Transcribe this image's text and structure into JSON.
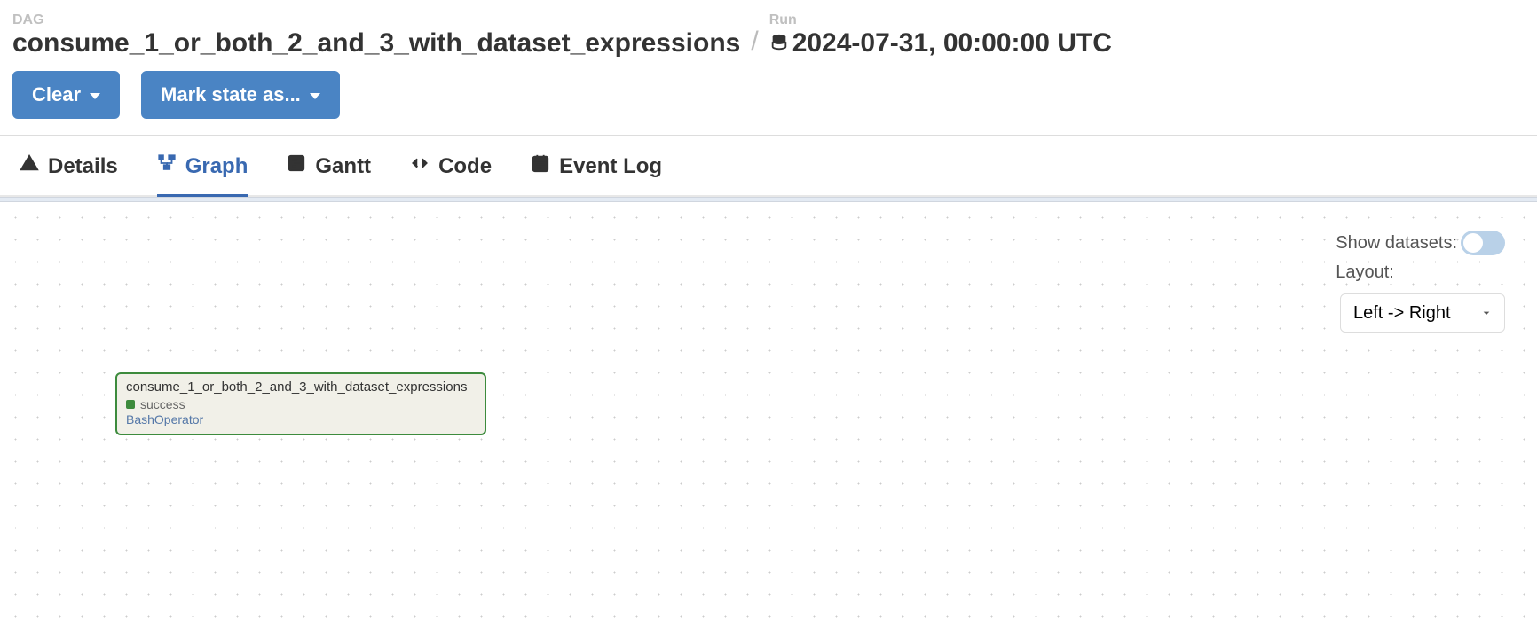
{
  "breadcrumb": {
    "dag_label": "DAG",
    "dag_name": "consume_1_or_both_2_and_3_with_dataset_expressions",
    "run_label": "Run",
    "run_timestamp": "2024-07-31, 00:00:00 UTC"
  },
  "actions": {
    "clear_label": "Clear",
    "mark_state_label": "Mark state as..."
  },
  "tabs": {
    "details": "Details",
    "graph": "Graph",
    "gantt": "Gantt",
    "code": "Code",
    "event_log": "Event Log"
  },
  "graph_controls": {
    "show_datasets_label": "Show datasets:",
    "layout_label": "Layout:",
    "layout_value": "Left -> Right"
  },
  "task_node": {
    "title": "consume_1_or_both_2_and_3_with_dataset_expressions",
    "status": "success",
    "operator": "BashOperator"
  }
}
